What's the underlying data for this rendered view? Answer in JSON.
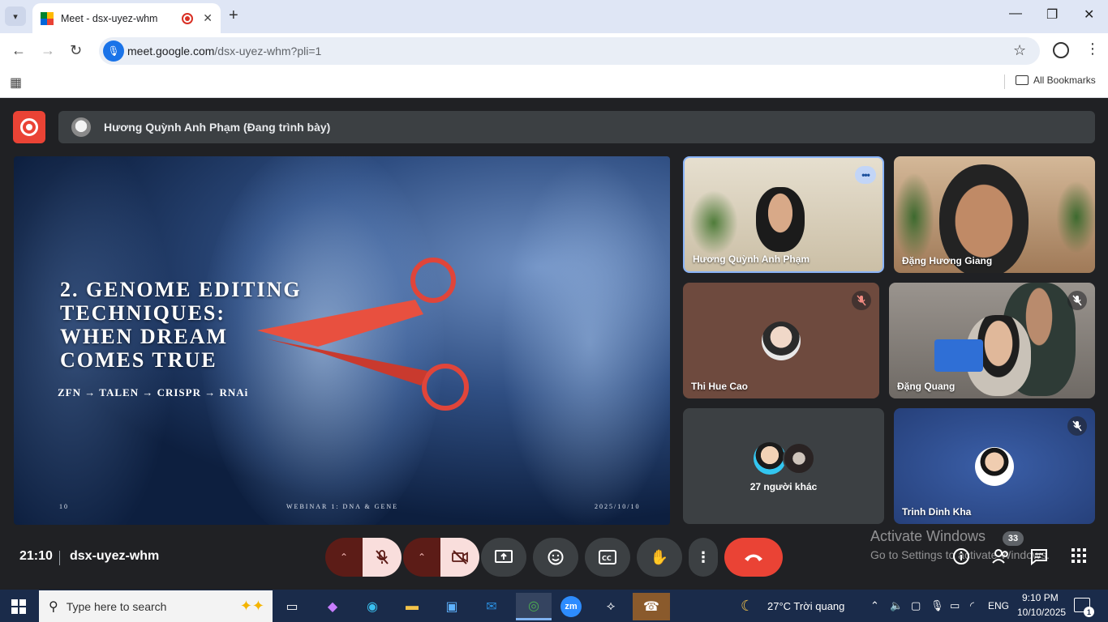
{
  "browser": {
    "tab_title": "Meet - dsx-uyez-whm",
    "url_host": "meet.google.com",
    "url_path": "/dsx-uyez-whm?pli=1",
    "all_bookmarks": "All Bookmarks"
  },
  "meet": {
    "presenter": "Hương Quỳnh Anh Phạm (Đang trình bày)",
    "slide": {
      "title": "2. GENOME EDITING\nTECHNIQUES:\nWHEN DREAM\nCOMES TRUE",
      "subtitle": "ZFN → TALEN → CRISPR → RNAi",
      "page_number": "10",
      "footer": "WEBINAR 1: DNA & GENE",
      "date": "2025/10/10"
    },
    "participants": [
      {
        "name": "Hương Quỳnh Anh Phạm",
        "bg": "#d8cdb8",
        "muted": false,
        "more": "•••"
      },
      {
        "name": "Đặng Hương Giang",
        "bg": "#b79778",
        "muted": false
      },
      {
        "name": "Thi Hue Cao",
        "bg": "#6e4a3e",
        "muted": true
      },
      {
        "name": "Đặng Quang",
        "bg": "#8f8a85",
        "muted": true
      },
      {
        "name": "27 người khác",
        "bg": "#3c4043",
        "muted": false
      },
      {
        "name": "Trinh Dinh Kha",
        "bg": "#2f4f8e",
        "muted": true
      }
    ],
    "time": "21:10",
    "meeting_code": "dsx-uyez-whm",
    "people_count": "33",
    "activate_title": "Activate Windows",
    "activate_sub": "Go to Settings to activate Windows."
  },
  "taskbar": {
    "search_placeholder": "Type here to search",
    "weather": "27°C  Trời quang",
    "language": "ENG",
    "clock_time": "9:10 PM",
    "clock_date": "10/10/2025",
    "notification_count": "1",
    "zoom_label": "zm"
  },
  "colors": {
    "record_red": "#ea4335",
    "muted_bg": "#5c1c17",
    "muted_fg": "#f9dedc"
  }
}
